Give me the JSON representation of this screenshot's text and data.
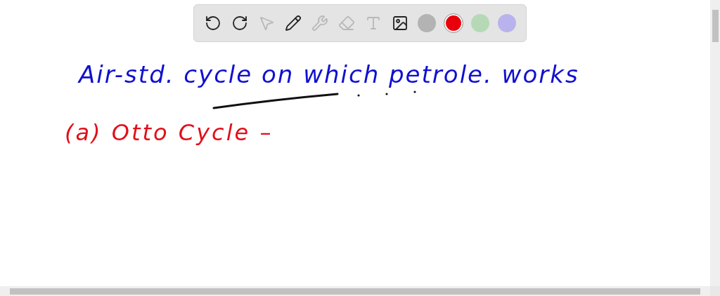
{
  "toolbar": {
    "tools": [
      {
        "kind": "undo",
        "disabled": false
      },
      {
        "kind": "redo",
        "disabled": false
      },
      {
        "kind": "select",
        "disabled": true
      },
      {
        "kind": "pen",
        "disabled": false
      },
      {
        "kind": "tools",
        "disabled": true
      },
      {
        "kind": "eraser",
        "disabled": true
      },
      {
        "kind": "text",
        "disabled": true
      },
      {
        "kind": "image",
        "disabled": false
      }
    ],
    "colors": [
      {
        "color": "#b3b3b3",
        "selected": false
      },
      {
        "color": "#e8000b",
        "selected": true
      },
      {
        "color": "#b5d9b5",
        "selected": false
      },
      {
        "color": "#b8b3ec",
        "selected": false
      }
    ]
  },
  "canvas": {
    "lines": [
      {
        "text": "Air-std. cycle on which petrole. works",
        "color": "#1010d0"
      },
      {
        "text": "(a) Otto Cycle –",
        "color": "#e0101a"
      }
    ]
  }
}
